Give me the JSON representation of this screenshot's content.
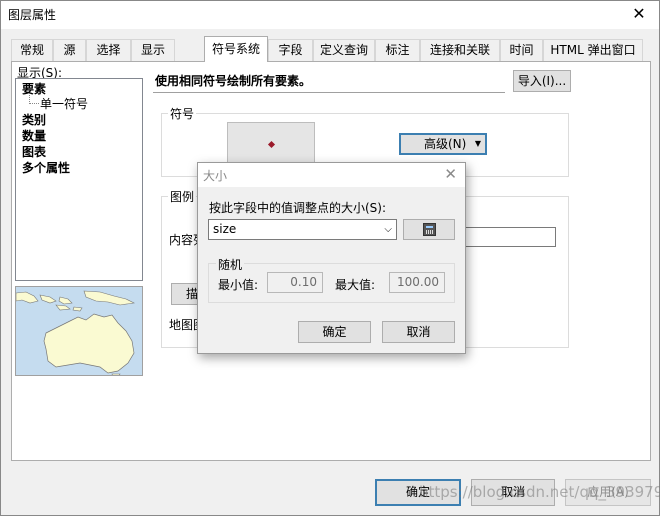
{
  "window": {
    "title": "图层属性",
    "close_glyph": "✕"
  },
  "tabs": [
    {
      "label": "常规"
    },
    {
      "label": "源"
    },
    {
      "label": "选择"
    },
    {
      "label": "显示"
    },
    {
      "label": "符号系统",
      "active": true
    },
    {
      "label": "字段"
    },
    {
      "label": "定义查询"
    },
    {
      "label": "标注"
    },
    {
      "label": "连接和关联"
    },
    {
      "label": "时间"
    },
    {
      "label": "HTML 弹出窗口"
    }
  ],
  "symbology": {
    "show_label": "显示(S):",
    "tree": {
      "features": "要素",
      "single_symbol": "单一符号",
      "categories": "类别",
      "quantities": "数量",
      "charts": "图表",
      "multiple_attributes": "多个属性"
    },
    "description": "使用相同符号绘制所有要素。",
    "import_button": "导入(I)...",
    "symbol_group": "符号",
    "advanced_button": "高级(N)",
    "legend_group": "图例",
    "label_partial": "内容列",
    "desc_button_partial": "描",
    "map_tip_partial": "地图图"
  },
  "dialog": {
    "title": "大小",
    "close_glyph": "✕",
    "field_prompt": "按此字段中的值调整点的大小(S):",
    "field_value": "size",
    "random_group": "随机",
    "min_label": "最小值:",
    "min_value": "0.10",
    "max_label": "最大值:",
    "max_value": "100.00",
    "ok": "确定",
    "cancel": "取消"
  },
  "footer": {
    "ok": "确定",
    "cancel": "取消",
    "apply": "应用(A)"
  },
  "watermark": "https://blog.csdn.net/qq_39397927",
  "colors": {
    "symbol_point": "#9b1b2b",
    "ocean": "#c5dcef",
    "land": "#fafad2",
    "default_button_border": "#3c7fb1"
  }
}
